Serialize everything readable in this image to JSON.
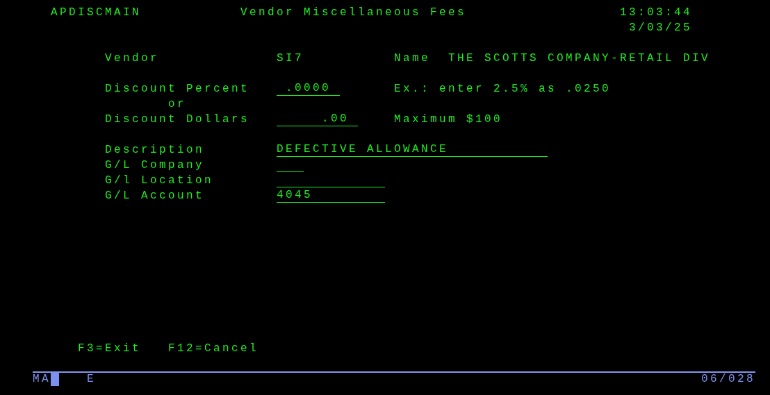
{
  "header": {
    "program": "APDISCMAIN",
    "title": "Vendor Miscellaneous Fees",
    "time": "13:03:44",
    "date": "3/03/25"
  },
  "vendor": {
    "label": "Vendor",
    "code": "SI7",
    "name_label": "Name",
    "name": "THE SCOTTS COMPANY-RETAIL DIV"
  },
  "discount": {
    "percent": {
      "label": "Discount Percent",
      "value": ".0000",
      "hint": "Ex.: enter 2.5% as .0250"
    },
    "connector": "or",
    "dollars": {
      "label": "Discount Dollars",
      "value": ".00",
      "hint": "Maximum $100"
    }
  },
  "gl_fields": [
    {
      "label": "Description",
      "value": "DEFECTIVE ALLOWANCE"
    },
    {
      "label": "G/L Company"
    },
    {
      "label": "G/l Location"
    },
    {
      "label": "G/L Account",
      "value": "4045"
    }
  ],
  "function_keys": [
    "F3=Exit",
    "F12=Cancel"
  ],
  "status_bar": {
    "indicators": [
      "M",
      "A"
    ],
    "insert_flag": "E",
    "cursor_position": "06/028"
  }
}
